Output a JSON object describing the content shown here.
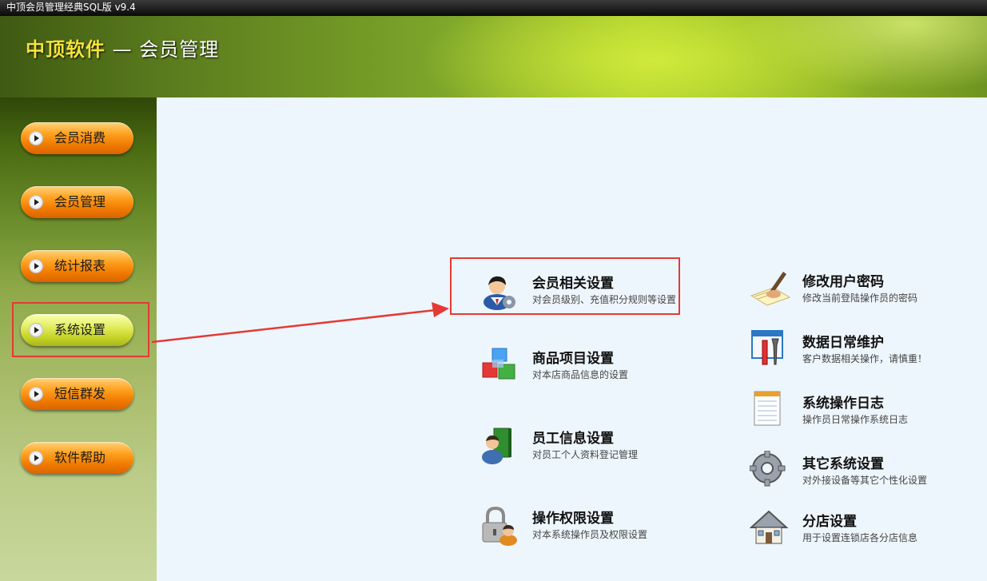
{
  "window": {
    "title": "中顶会员管理经典SQL版 v9.4"
  },
  "header": {
    "brand": "中顶软件",
    "subtitle": " — 会员管理"
  },
  "sidebar": {
    "items": [
      {
        "label": "会员消费"
      },
      {
        "label": "会员管理"
      },
      {
        "label": "统计报表"
      },
      {
        "label": "系统设置",
        "active": true
      },
      {
        "label": "短信群发"
      },
      {
        "label": "软件帮助"
      }
    ]
  },
  "settings": {
    "left": [
      {
        "icon": "member-settings-icon",
        "title": "会员相关设置",
        "desc": "对会员级别、充值积分规则等设置"
      },
      {
        "icon": "product-cubes-icon",
        "title": "商品项目设置",
        "desc": "对本店商品信息的设置"
      },
      {
        "icon": "employee-book-icon",
        "title": "员工信息设置",
        "desc": "对员工个人资料登记管理"
      },
      {
        "icon": "lock-user-icon",
        "title": "操作权限设置",
        "desc": "对本系统操作员及权限设置"
      }
    ],
    "right": [
      {
        "icon": "pen-paper-icon",
        "title": "修改用户密码",
        "desc": "修改当前登陆操作员的密码"
      },
      {
        "icon": "maintenance-tools-icon",
        "title": "数据日常维护",
        "desc": "客户数据相关操作，请慎重！"
      },
      {
        "icon": "log-notepad-icon",
        "title": "系统操作日志",
        "desc": "操作员日常操作系统日志"
      },
      {
        "icon": "gear-icon",
        "title": "其它系统设置",
        "desc": "对外接设备等其它个性化设置"
      },
      {
        "icon": "house-icon",
        "title": "分店设置",
        "desc": "用于设置连锁店各分店信息"
      }
    ]
  },
  "annotation_color": "#e53935",
  "colors": {
    "accent_orange": "#f07b00",
    "active_yellow": "#c8d62a",
    "content_bg": "#eef6fd"
  }
}
